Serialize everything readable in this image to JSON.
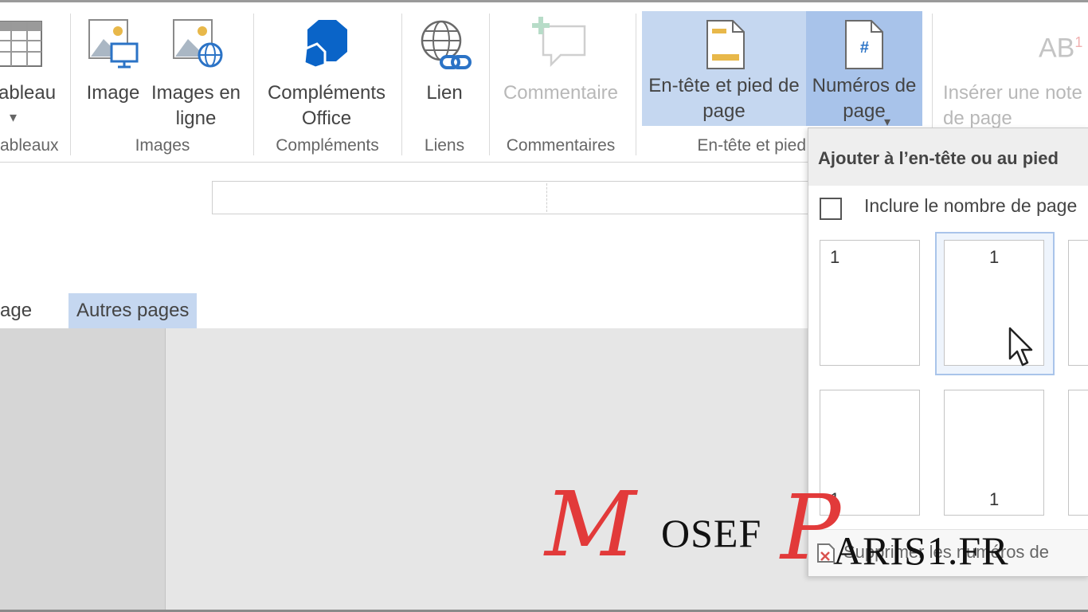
{
  "ribbon": {
    "tableau": {
      "label": "ableau",
      "arrow": "▾"
    },
    "image": {
      "label": "Image"
    },
    "images_en_ligne": {
      "label": "Images en ligne"
    },
    "complements_office": {
      "label": "Compléments Office"
    },
    "lien": {
      "label": "Lien"
    },
    "commentaire": {
      "label": "Commentaire"
    },
    "entete_pied": {
      "label": "En-tête et pied de page"
    },
    "numeros_page": {
      "label": "Numéros de page",
      "arrow": "▾"
    },
    "note": {
      "label": "Insérer une note de page",
      "icon_text": "AB",
      "icon_sup": "1"
    },
    "groups": {
      "tableaux": "ableaux",
      "images": "Images",
      "complements": "Compléments",
      "liens": "Liens",
      "commentaires": "Commentaires",
      "entete": "En-tête et pied"
    },
    "colors": {
      "highlight": "#c5d7f0",
      "pressed": "#a8c3ea",
      "office_blue": "#0a64c8",
      "accent_gold": "#e8b84a"
    }
  },
  "icons": {
    "tableau": "table-icon",
    "image": "picture-icon",
    "images_en_ligne": "online-picture-icon",
    "complements": "office-addins-icon",
    "lien": "link-icon",
    "commentaire": "comment-icon",
    "entete": "header-footer-icon",
    "numeros": "page-number-icon",
    "note": "footnote-icon"
  },
  "tabs": {
    "page": "age",
    "autres_pages": "Autres pages"
  },
  "dropdown": {
    "header": "Ajouter à l’en-tête ou au pied",
    "checkbox_label": "Inclure le nombre de page",
    "checkbox_checked": false,
    "thumbs": [
      {
        "number": "1",
        "position": "top-left"
      },
      {
        "number": "1",
        "position": "top-center"
      },
      {
        "number": "1",
        "position": "bottom-left"
      },
      {
        "number": "1",
        "position": "bottom-center"
      }
    ],
    "footer": "Supprimer les numéros de"
  },
  "watermark": {
    "m": "M",
    "osef": "OSEF",
    "p": "P",
    "aris": "ARIS1.FR"
  }
}
